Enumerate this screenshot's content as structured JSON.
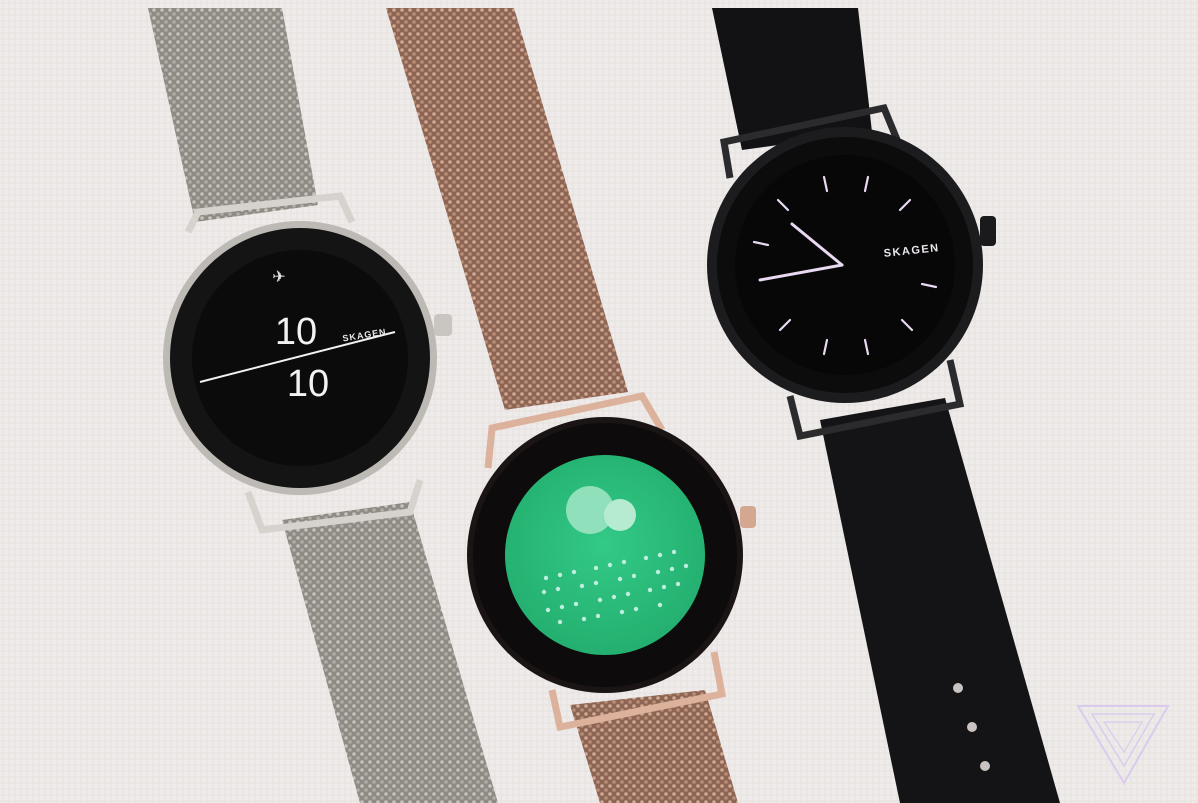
{
  "watches": [
    {
      "id": "silver",
      "brand": "SKAGEN",
      "hours": "10",
      "minutes": "10",
      "strap_color": "#a9a49b",
      "case_color": "#bfbcb7",
      "face_color": "#0b0b0c",
      "icon": "airplane-icon"
    },
    {
      "id": "rose-gold",
      "face_color": "#2fbf7e",
      "strap_color": "#b98f78",
      "case_color": "#d7a88f",
      "icon": "bubble-icon"
    },
    {
      "id": "black",
      "brand": "SKAGEN",
      "strap_color": "#121214",
      "case_color": "#1a1a1c",
      "face_color": "#070708",
      "hand_color": "#e9d9f2"
    }
  ],
  "watermark": {
    "icon": "verge-logo-icon",
    "color": "#d9c8ef"
  }
}
